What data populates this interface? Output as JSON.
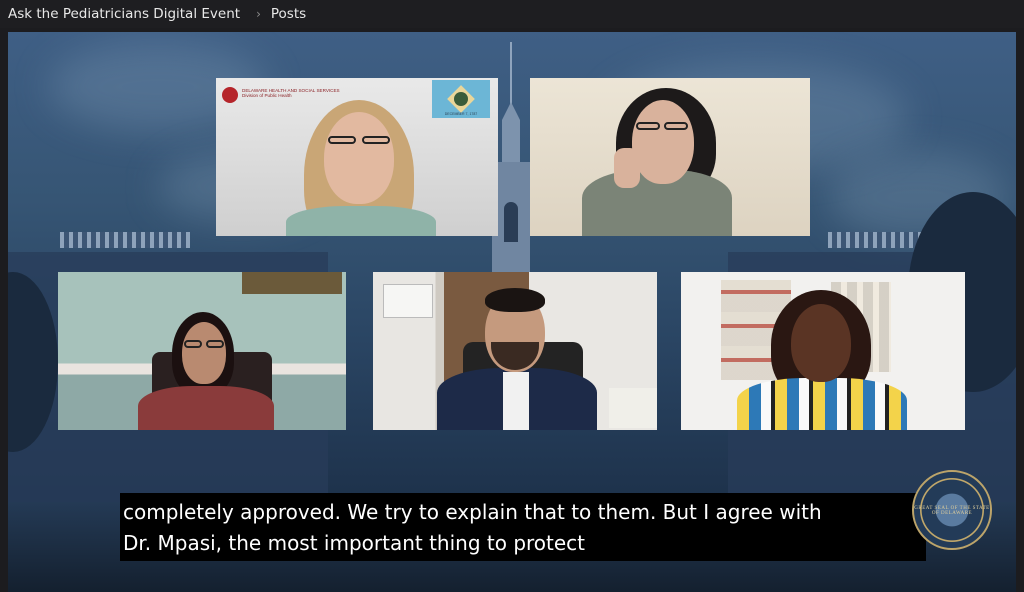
{
  "breadcrumb": {
    "event": "Ask the Pediatricians Digital Event",
    "separator": "›",
    "section": "Posts"
  },
  "tiles": {
    "top_left": {
      "logo_line1": "DELAWARE HEALTH AND SOCIAL SERVICES",
      "logo_line2": "Division of Public Health",
      "flag_caption": "DECEMBER 7, 1787"
    }
  },
  "captions": {
    "line1": "completely approved. We try to explain that to them. But I agree with",
    "line2": "Dr. Mpasi, the most important thing to protect"
  },
  "seal": {
    "text": "GREAT SEAL OF THE STATE OF DELAWARE"
  },
  "colors": {
    "background": "#1c1c1f",
    "caption_bg": "#000000",
    "caption_text": "#ffffff",
    "video_bg": "#2f4e70"
  }
}
